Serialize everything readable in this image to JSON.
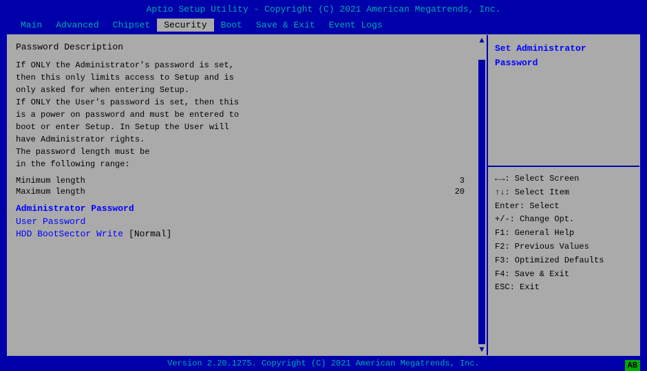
{
  "title_bar": {
    "text": "Aptio Setup Utility - Copyright (C) 2021 American Megatrends, Inc."
  },
  "menu": {
    "items": [
      {
        "label": "Main",
        "active": false
      },
      {
        "label": "Advanced",
        "active": false
      },
      {
        "label": "Chipset",
        "active": false
      },
      {
        "label": "Security",
        "active": true
      },
      {
        "label": "Boot",
        "active": false
      },
      {
        "label": "Save & Exit",
        "active": false
      },
      {
        "label": "Event Logs",
        "active": false
      }
    ]
  },
  "left_panel": {
    "title": "Password Description",
    "description_lines": [
      "If ONLY the Administrator's password is set,",
      "then this only limits access to Setup and is",
      "only asked for when entering Setup.",
      "If ONLY the User's password is set, then this",
      "is a power on password and must be entered to",
      "boot or enter Setup. In Setup the User will",
      "have Administrator rights.",
      "The password length must be",
      "in the following range:"
    ],
    "min_label": "Minimum length",
    "min_value": "3",
    "max_label": "Maximum length",
    "max_value": "20",
    "section_header": "Administrator Password",
    "user_password_label": "User Password",
    "hdd_label": "HDD BootSector Write",
    "hdd_value": "[Normal]"
  },
  "right_panel": {
    "top_title_line1": "Set Administrator",
    "top_title_line2": "Password",
    "help_items": [
      {
        "text": "←→: Select Screen"
      },
      {
        "text": "↑↓: Select Item"
      },
      {
        "text": "Enter: Select"
      },
      {
        "text": "+/-: Change Opt."
      },
      {
        "text": "F1: General Help"
      },
      {
        "text": "F2: Previous Values"
      },
      {
        "text": "F3: Optimized Defaults"
      },
      {
        "text": "F4: Save & Exit"
      },
      {
        "text": "ESC: Exit"
      }
    ]
  },
  "status_bar": {
    "text": "Version 2.20.1275. Copyright (C) 2021 American Megatrends, Inc.",
    "badge": "AB"
  }
}
